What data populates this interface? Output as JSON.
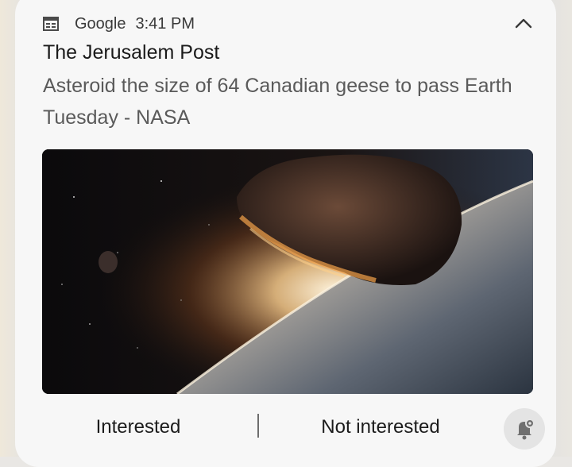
{
  "notification": {
    "app_icon": "calendar-icon",
    "app_name": "Google",
    "time": "3:41 PM",
    "title": "The Jerusalem Post",
    "body": "Asteroid the size of 64 Canadian geese to pass Earth Tuesday - NASA",
    "image_subject": "asteroid approaching earth",
    "collapse_icon": "chevron-up-icon"
  },
  "actions": {
    "interested_label": "Interested",
    "not_interested_label": "Not interested",
    "bell_icon": "bell-settings-icon"
  },
  "colors": {
    "card_bg": "#f7f7f7",
    "title_text": "#1b1b1b",
    "body_text": "#5a5a5a",
    "bell_bg": "#e4e4e4"
  }
}
